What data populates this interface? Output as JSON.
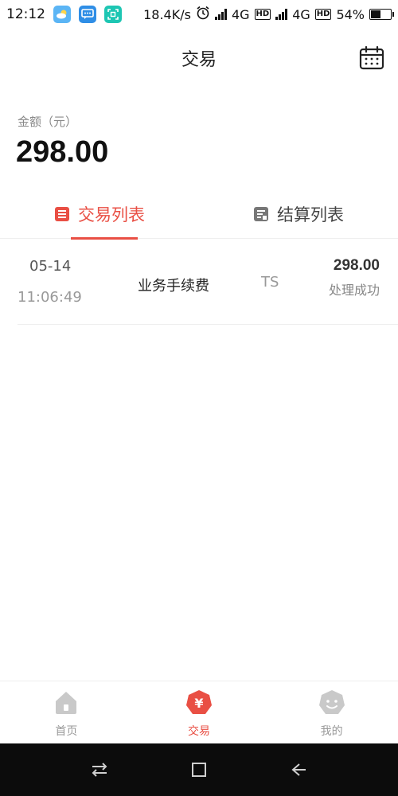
{
  "status_bar": {
    "time": "12:12",
    "net_speed": "18.4K/s",
    "network_type_1": "4G",
    "network_type_2": "4G",
    "hd_label": "HD",
    "battery": "54%",
    "battery_level": 0.54
  },
  "header": {
    "title": "交易"
  },
  "amount": {
    "label": "金额（元）",
    "value": "298.00"
  },
  "tabs": [
    {
      "label": "交易列表",
      "active": true
    },
    {
      "label": "结算列表",
      "active": false
    }
  ],
  "transactions": [
    {
      "date": "05-14",
      "time": "11:06:49",
      "name": "业务手续费",
      "code": "TS",
      "amount": "298.00",
      "status": "处理成功"
    }
  ],
  "bottom_nav": [
    {
      "label": "首页",
      "icon": "home-icon",
      "active": false
    },
    {
      "label": "交易",
      "icon": "yuan-icon",
      "active": true
    },
    {
      "label": "我的",
      "icon": "profile-icon",
      "active": false
    }
  ],
  "colors": {
    "accent": "#e94f44",
    "inactive_icon": "#c9c9c9",
    "divider": "#eeeeee"
  }
}
